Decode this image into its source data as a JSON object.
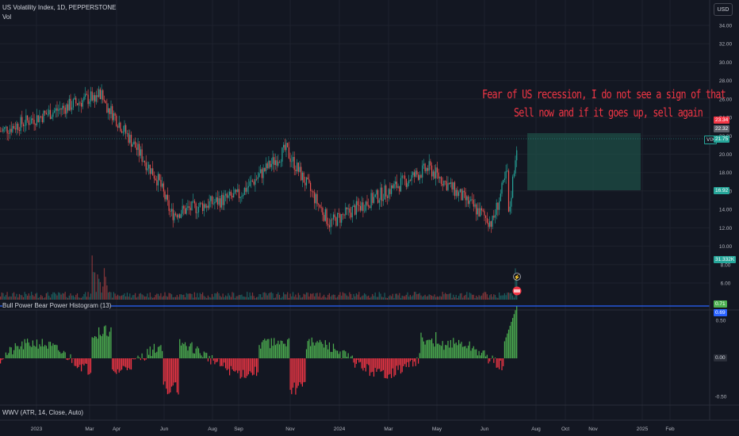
{
  "header": {
    "title": "US Volatility Index, 1D, PEPPERSTONE",
    "volume_label": "Vol",
    "currency": "USD"
  },
  "annotation": {
    "line1": "Fear of US recession, I do not see a sign of that",
    "line2": "Sell now and if it goes up, sell again"
  },
  "indicators": {
    "bbp_label": "Bull Power Bear Power Histogram (13)",
    "wwv_label": "WWV (ATR, 14, Close, Auto)"
  },
  "price_tags": {
    "red": "23.34",
    "gray": "22.32",
    "vix_prefix": "VIX",
    "current": "21.75",
    "target": "16.92",
    "volume": "31.332K"
  },
  "bbp_tags": {
    "green": "0.71",
    "blue": "0.69",
    "zero": "0.00"
  },
  "colors": {
    "background": "#131722",
    "up": "#26a69a",
    "down": "#ef5350",
    "hist_up": "#4caf50",
    "hist_down": "#f23645",
    "line": "#2962ff",
    "annotation": "#f23645",
    "target_box": "#1e4d45"
  },
  "chart_data": [
    {
      "type": "candlestick",
      "title": "US Volatility Index, 1D, PEPPERSTONE",
      "y_axis_ticks": [
        "34.00",
        "32.00",
        "30.00",
        "28.00",
        "26.00",
        "24.00",
        "22.00",
        "20.00",
        "18.00",
        "16.00",
        "14.00",
        "12.00",
        "10.00",
        "8.00",
        "6.00"
      ],
      "ylim": [
        5,
        35
      ],
      "x_axis_ticks": [
        "2023",
        "Mar",
        "Apr",
        "Jun",
        "Aug",
        "Sep",
        "Nov",
        "2024",
        "Mar",
        "May",
        "Jun",
        "Aug",
        "Oct",
        "Nov",
        "2025",
        "Feb"
      ],
      "key_closes": [
        {
          "date": "2023-01",
          "value": 22.5
        },
        {
          "date": "2023-03",
          "value": 26.5
        },
        {
          "date": "2023-05",
          "value": 17.0
        },
        {
          "date": "2023-06",
          "value": 13.5
        },
        {
          "date": "2023-08",
          "value": 15.5
        },
        {
          "date": "2023-10",
          "value": 20.5
        },
        {
          "date": "2023-12",
          "value": 12.5
        },
        {
          "date": "2024-04",
          "value": 18.5
        },
        {
          "date": "2024-07",
          "value": 12.5
        },
        {
          "date": "2024-08",
          "value": 21.75
        }
      ],
      "last": 21.75,
      "target_zone": {
        "from": 21.75,
        "to": 16.92
      },
      "volume_last": "31.332K"
    },
    {
      "type": "bar",
      "title": "Bull Power Bear Power Histogram (13)",
      "y_axis_ticks": [
        "0.50",
        "0.00",
        "-0.50"
      ],
      "ylim": [
        -0.6,
        0.8
      ],
      "last": 0.71,
      "signal": 0.69
    }
  ]
}
